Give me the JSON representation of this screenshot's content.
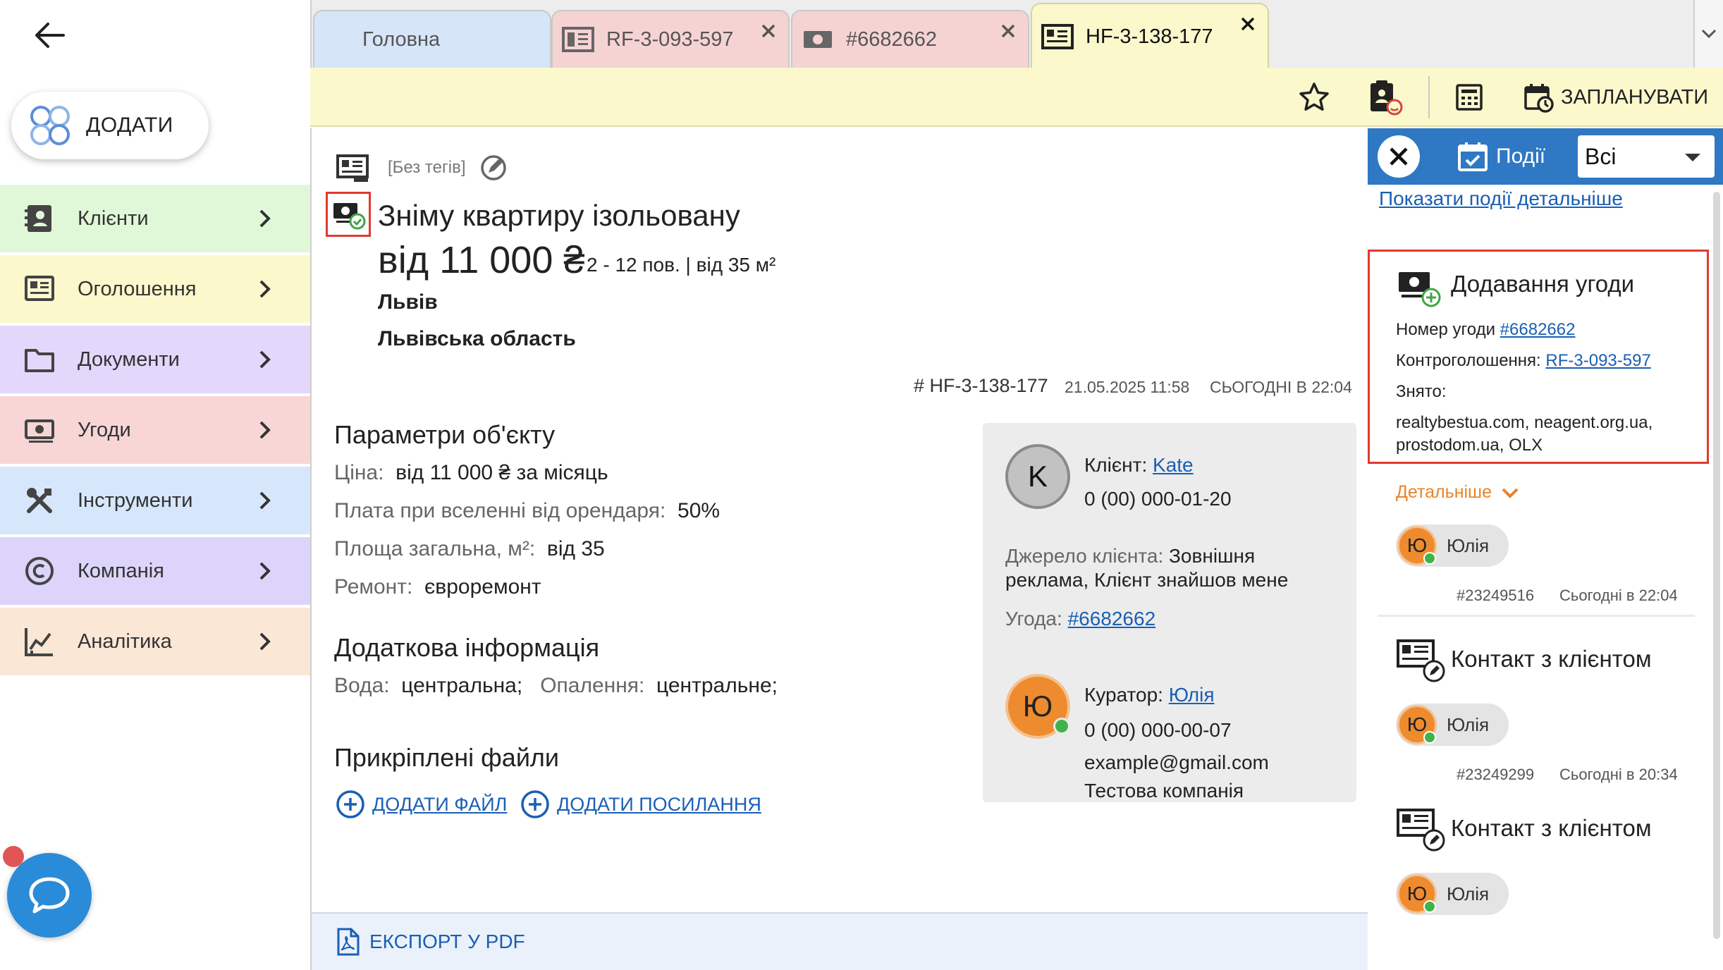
{
  "sidebar": {
    "add_label": "ДОДАТИ",
    "items": [
      {
        "label": "Клієнти",
        "icon": "contact-book-icon",
        "color": "#e0f8d8"
      },
      {
        "label": "Оголошення",
        "icon": "listing-icon",
        "color": "#fbf8cc"
      },
      {
        "label": "Документи",
        "icon": "folder-icon",
        "color": "#e3d7fb"
      },
      {
        "label": "Угоди",
        "icon": "money-icon",
        "color": "#f8d6d6"
      },
      {
        "label": "Інструменти",
        "icon": "tools-icon",
        "color": "#d7e7fb"
      },
      {
        "label": "Компанія",
        "icon": "copyright-icon",
        "color": "#dcd4fa"
      },
      {
        "label": "Аналітика",
        "icon": "analytics-icon",
        "color": "#fbe7d6"
      }
    ]
  },
  "tabs": [
    {
      "label": "Головна",
      "color": "#d6e5f8"
    },
    {
      "label": "RF-3-093-597",
      "color": "#f6d3d3"
    },
    {
      "label": "#6682662",
      "color": "#f6d3d3"
    },
    {
      "label": "HF-3-138-177",
      "color": "#fbf8cc"
    }
  ],
  "toolbar": {
    "schedule_label": "ЗАПЛАНУВАТИ"
  },
  "listing": {
    "tags": "[Без тегів]",
    "title": "Зніму квартиру ізольовану",
    "price": "від 11 000 ₴",
    "floors_area": "2 - 12 пов. | від 35 м²",
    "city": "Львів",
    "region": "Львівська область",
    "id": "# HF-3-138-177",
    "created": "21.05.2025 11:58",
    "updated": "СЬОГОДНІ В 22:04"
  },
  "params": {
    "title": "Параметри об'єкту",
    "rows": [
      {
        "key": "Ціна:",
        "value": "від 11 000 ₴ за місяць"
      },
      {
        "key": "Плата при вселенні від орендаря:",
        "value": "50%"
      },
      {
        "key": "Площа загальна, м²:",
        "value": "від 35"
      },
      {
        "key": "Ремонт:",
        "value": "євроремонт"
      }
    ]
  },
  "extra": {
    "title": "Додаткова інформація",
    "water_key": "Вода:",
    "water_val": "центральна;",
    "heat_key": "Опалення:",
    "heat_val": "центральне;"
  },
  "files": {
    "title": "Прикріплені файли",
    "add_file": "ДОДАТИ ФАЙЛ",
    "add_link": "ДОДАТИ ПОСИЛАННЯ"
  },
  "client_card": {
    "client_initial": "K",
    "client_label": "Клієнт:",
    "client_name": "Kate",
    "client_phone": "0 (00) 000-01-20",
    "source_label": "Джерело клієнта:",
    "source_line1": "Зовнішня",
    "source_line2": "реклама, Клієнт знайшов мене",
    "deal_label": "Угода:",
    "deal_link": "#6682662",
    "curator_initial": "Ю",
    "curator_label": "Куратор:",
    "curator_name": "Юлія",
    "curator_phone": "0 (00) 000-00-07",
    "curator_email": "example@gmail.com",
    "curator_company": "Тестова компанія"
  },
  "footer": {
    "export_label": "ЕКСПОРТ У PDF"
  },
  "events": {
    "title": "Події",
    "filter": "Всі",
    "details_link": "Показати події детальніше",
    "items": [
      {
        "title": "Додавання угоди",
        "deal_label": "Номер угоди",
        "deal_link": "#6682662",
        "counter_label": "Контроголошення:",
        "counter_link": "RF-3-093-597",
        "taken_label": "Знято:",
        "taken_line1": "realtybestua.com, neagent.org.ua,",
        "taken_line2": "prostodom.ua, OLX",
        "more": "Детальніше",
        "user_initial": "Ю",
        "user": "Юлія",
        "num": "#23249516",
        "time": "Сьогодні в 22:04"
      },
      {
        "title": "Контакт з клієнтом",
        "user_initial": "Ю",
        "user": "Юлія",
        "num": "#23249299",
        "time": "Сьогодні в 20:34"
      },
      {
        "title": "Контакт з клієнтом",
        "user_initial": "Ю",
        "user": "Юлія"
      }
    ]
  }
}
